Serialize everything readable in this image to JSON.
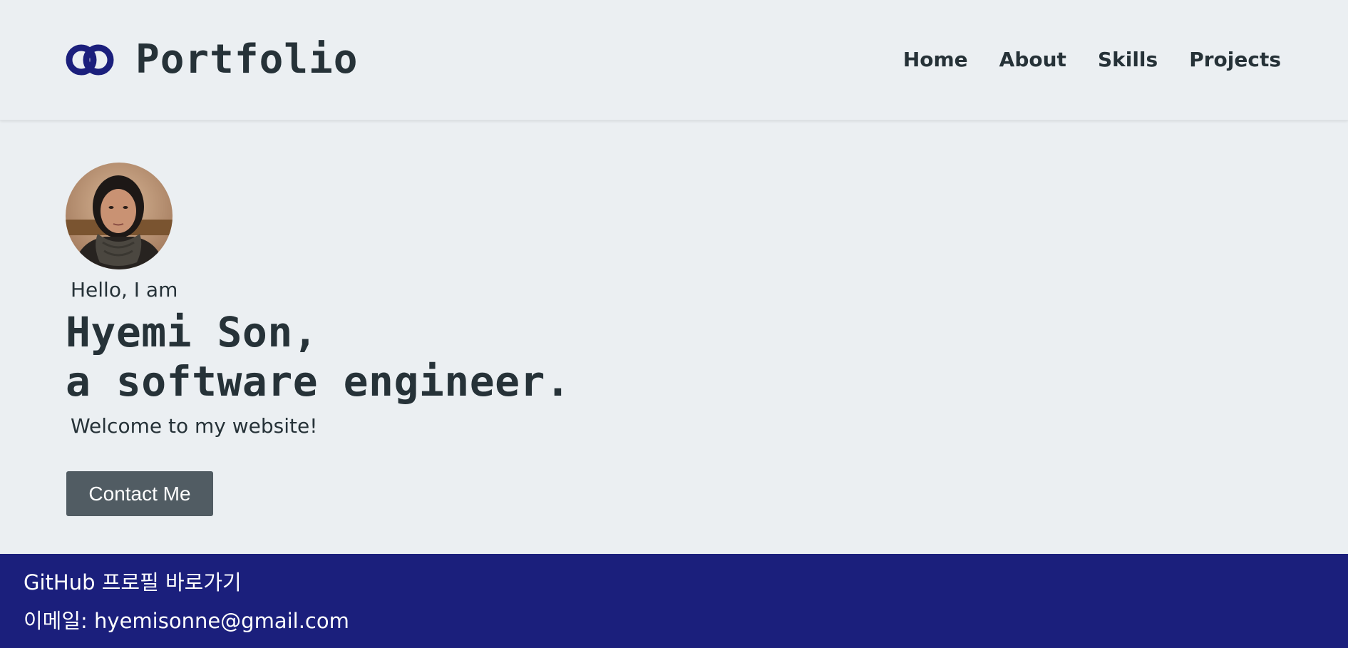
{
  "header": {
    "logo_text": "Portfolio",
    "logo_icon": "interlocking-rings-icon",
    "nav": [
      {
        "label": "Home"
      },
      {
        "label": "About"
      },
      {
        "label": "Skills"
      },
      {
        "label": "Projects"
      }
    ]
  },
  "hero": {
    "avatar": "profile-photo",
    "greeting": "Hello, I am",
    "name_line": "Hyemi Son,",
    "role_line": "a software engineer.",
    "welcome": "Welcome to my website!",
    "contact_button": "Contact Me"
  },
  "footer": {
    "github_link": "GitHub 프로필 바로가기",
    "email_line": "이메일: hyemisonne@gmail.com"
  },
  "colors": {
    "background": "#ebeff2",
    "text": "#263238",
    "accent": "#1b1f7c",
    "button": "#515c63"
  }
}
